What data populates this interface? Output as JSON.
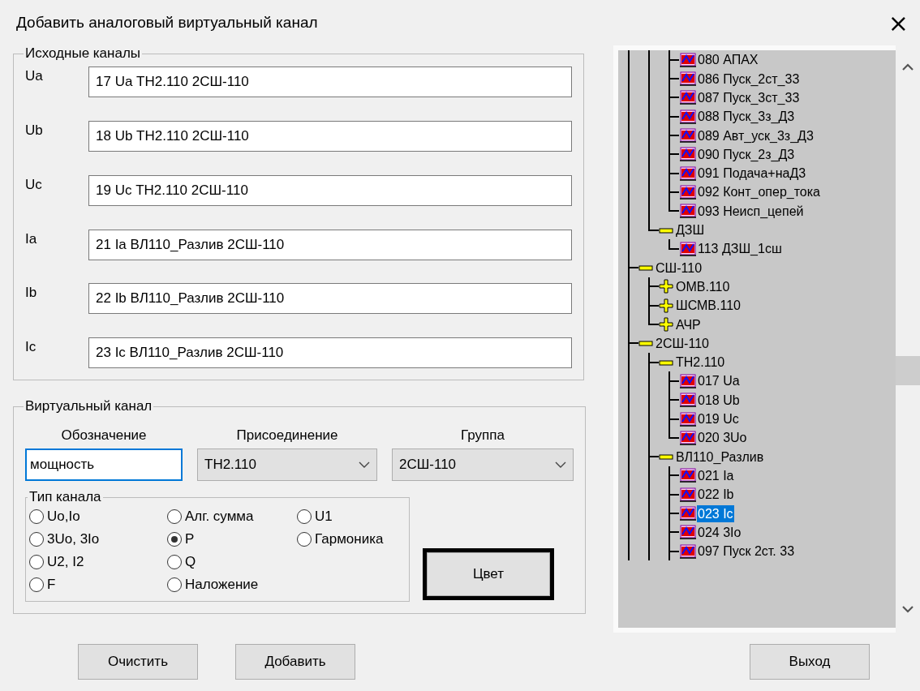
{
  "window": {
    "title": "Добавить аналоговый виртуальный канал",
    "close": "×"
  },
  "source_channels": {
    "title": "Исходные каналы",
    "rows": [
      {
        "label": "Ua",
        "value": "17 Ua ТН2.110 2СШ-110"
      },
      {
        "label": "Ub",
        "value": "18 Ub ТН2.110 2СШ-110"
      },
      {
        "label": "Uc",
        "value": "19 Uc ТН2.110 2СШ-110"
      },
      {
        "label": "Ia",
        "value": "21 Ia ВЛ110_Разлив 2СШ-110"
      },
      {
        "label": "Ib",
        "value": "22 Ib ВЛ110_Разлив 2СШ-110"
      },
      {
        "label": "Ic",
        "value": "23 Ic ВЛ110_Разлив 2СШ-110"
      }
    ]
  },
  "virtual_channel": {
    "title": "Виртуальный канал",
    "designation": {
      "label": "Обозначение",
      "value": "мощность"
    },
    "connection": {
      "label": "Присоединение",
      "value": "ТН2.110"
    },
    "group": {
      "label": "Группа",
      "value": "2СШ-110"
    },
    "channel_type": {
      "title": "Тип канала",
      "options": [
        {
          "label": "Uo,Io",
          "selected": false
        },
        {
          "label": "3Uo, 3Io",
          "selected": false
        },
        {
          "label": "U2, I2",
          "selected": false
        },
        {
          "label": "F",
          "selected": false
        },
        {
          "label": "Алг. сумма",
          "selected": false
        },
        {
          "label": "P",
          "selected": true
        },
        {
          "label": "Q",
          "selected": false
        },
        {
          "label": "Наложение",
          "selected": false
        },
        {
          "label": "U1",
          "selected": false
        },
        {
          "label": "Гармоника",
          "selected": false
        }
      ]
    },
    "color_button": "Цвет"
  },
  "tree": {
    "items": [
      {
        "kind": "partial",
        "children": [
          {
            "kind": "partial",
            "children": [
              {
                "kind": "channel",
                "label": "080 АПАХ",
                "selected": false
              },
              {
                "kind": "channel",
                "label": "086 Пуск_2ст_33",
                "selected": false
              },
              {
                "kind": "channel",
                "label": "087 Пуск_3ст_33",
                "selected": false
              },
              {
                "kind": "channel",
                "label": "088 Пуск_3з_Д3",
                "selected": false
              },
              {
                "kind": "channel",
                "label": "089 Авт_уск_3з_Д3",
                "selected": false
              },
              {
                "kind": "channel",
                "label": "090 Пуск_2з_Д3",
                "selected": false
              },
              {
                "kind": "channel",
                "label": "091 Подача+наД3",
                "selected": false
              },
              {
                "kind": "channel",
                "label": "092 Конт_опер_тока",
                "selected": false
              },
              {
                "kind": "channel",
                "label": "093 Неисп_цепей",
                "selected": false
              }
            ]
          },
          {
            "kind": "group",
            "label": "ДЗШ",
            "expanded": true,
            "children": [
              {
                "kind": "channel",
                "label": "113 ДЗШ_1сш",
                "selected": false
              }
            ]
          }
        ]
      },
      {
        "kind": "group",
        "label": "СШ-110",
        "expanded": true,
        "children": [
          {
            "kind": "group",
            "label": "ОМВ.110",
            "expanded": false
          },
          {
            "kind": "group",
            "label": "ШСМВ.110",
            "expanded": false
          },
          {
            "kind": "group",
            "label": "АЧР",
            "expanded": false
          }
        ]
      },
      {
        "kind": "group",
        "label": "2СШ-110",
        "expanded": true,
        "children": [
          {
            "kind": "group",
            "label": "ТН2.110",
            "expanded": true,
            "children": [
              {
                "kind": "channel",
                "label": "017 Ua",
                "selected": false
              },
              {
                "kind": "channel",
                "label": "018 Ub",
                "selected": false
              },
              {
                "kind": "channel",
                "label": "019 Uc",
                "selected": false
              },
              {
                "kind": "channel",
                "label": "020 3Uo",
                "selected": false
              }
            ]
          },
          {
            "kind": "group",
            "label": "ВЛ110_Разлив",
            "expanded": true,
            "children": [
              {
                "kind": "channel",
                "label": "021 Ia",
                "selected": false
              },
              {
                "kind": "channel",
                "label": "022 Ib",
                "selected": false
              },
              {
                "kind": "channel",
                "label": "023 Ic",
                "selected": true
              },
              {
                "kind": "channel",
                "label": "024 3Io",
                "selected": false
              },
              {
                "kind": "channel",
                "label": "097 Пуск 2ст. 33",
                "selected": false
              }
            ]
          }
        ]
      }
    ]
  },
  "buttons": {
    "clear": "Очистить",
    "add": "Добавить",
    "exit": "Выход"
  }
}
